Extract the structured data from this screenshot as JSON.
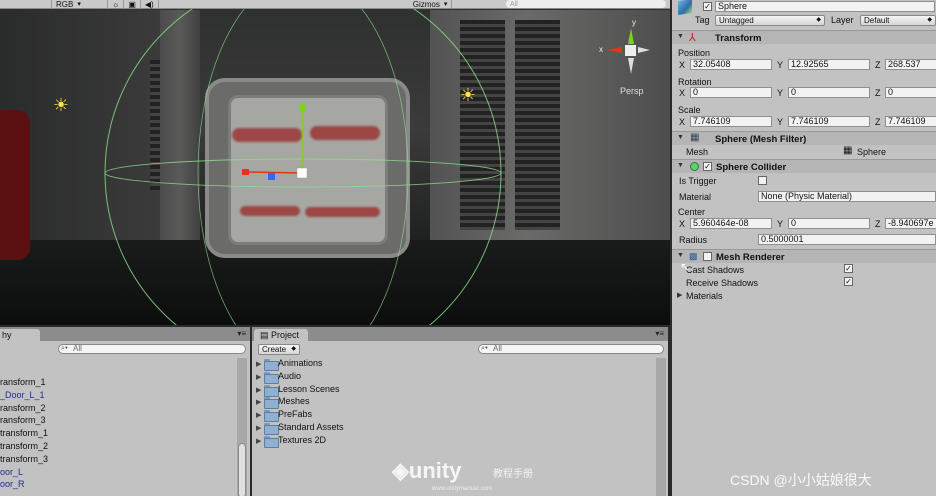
{
  "scene": {
    "toolbar": {
      "rgb": "RGB",
      "gizmos": "Gizmos",
      "search_placeholder": "All"
    },
    "persp_label": "Persp",
    "axis_y": "y",
    "axis_x": "x"
  },
  "inspector": {
    "object_name": "Sphere",
    "tag_label": "Tag",
    "tag_value": "Untagged",
    "layer_label": "Layer",
    "layer_value": "Default",
    "transform": {
      "title": "Transform",
      "position_label": "Position",
      "rotation_label": "Rotation",
      "scale_label": "Scale",
      "position": {
        "x": "32.05408",
        "y": "12.92565",
        "z": "268.537"
      },
      "rotation": {
        "x": "0",
        "y": "0",
        "z": "0"
      },
      "scale": {
        "x": "7.746109",
        "y": "7.746109",
        "z": "7.746109"
      },
      "x_label": "X",
      "y_label": "Y",
      "z_label": "Z"
    },
    "mesh_filter": {
      "title": "Sphere (Mesh Filter)",
      "mesh_label": "Mesh",
      "mesh_value": "Sphere"
    },
    "sphere_collider": {
      "title": "Sphere Collider",
      "is_trigger_label": "Is Trigger",
      "material_label": "Material",
      "material_value": "None (Physic Material)",
      "center_label": "Center",
      "center": {
        "x": "5.960464e-08",
        "y": "0",
        "z": "-8.940697e"
      },
      "radius_label": "Radius",
      "radius_value": "0.5000001"
    },
    "mesh_renderer": {
      "title": "Mesh Renderer",
      "cast_shadows_label": "Cast Shadows",
      "receive_shadows_label": "Receive Shadows",
      "materials_label": "Materials"
    }
  },
  "hierarchy": {
    "tab_label": "hy",
    "search_placeholder": "All",
    "items": [
      {
        "label": "ransform_1",
        "color": "#111111"
      },
      {
        "label": "_Door_L_1",
        "color": "#1c2f86"
      },
      {
        "label": "ransform_2",
        "color": "#111111"
      },
      {
        "label": "ransform_3",
        "color": "#111111"
      },
      {
        "label": "transform_1",
        "color": "#111111"
      },
      {
        "label": "transform_2",
        "color": "#111111"
      },
      {
        "label": "transform_3",
        "color": "#111111"
      },
      {
        "label": "oor_L",
        "color": "#1c2f86"
      },
      {
        "label": "oor_R",
        "color": "#1c2f86"
      }
    ]
  },
  "project": {
    "tab_label": "Project",
    "create_label": "Create",
    "search_placeholder": "All",
    "folders": [
      "Animations",
      "Audio",
      "Lesson Scenes",
      "Meshes",
      "PreFabs",
      "Standard Assets",
      "Textures 2D"
    ]
  },
  "watermarks": {
    "unity": "unity",
    "unity_sub": "教程手册",
    "unity_url": "www.unitymanual.com",
    "csdn": "CSDN @小小姑娘很大"
  },
  "colors": {
    "accent_blue": "#1c2f86",
    "gizmo_green": "#9cff9c",
    "axis_red": "#e0351a",
    "axis_green": "#7dd31a",
    "axis_blue": "#2a6bff"
  }
}
